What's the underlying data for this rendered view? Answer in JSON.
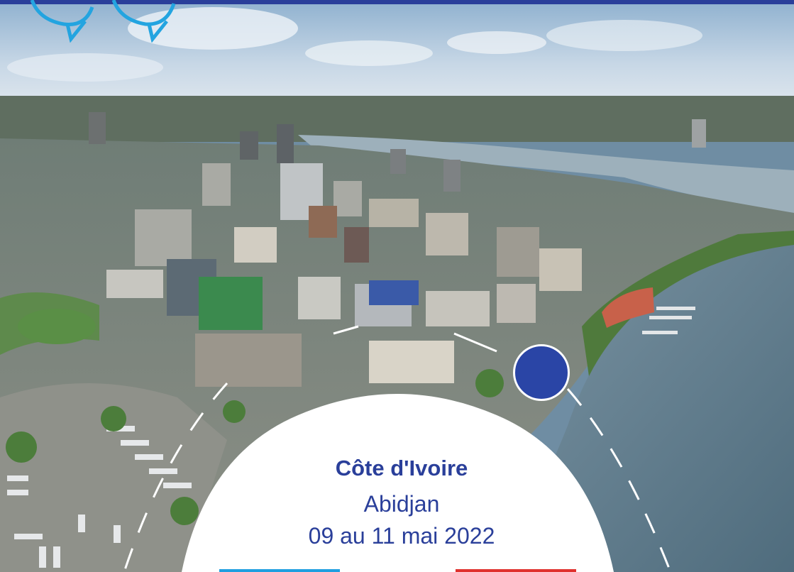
{
  "banner": {
    "country": "Côte d'Ivoire",
    "city": "Abidjan",
    "dates": "09 au 11 mai 2022"
  },
  "colors": {
    "brand_blue": "#2a3f9a",
    "marker_blue": "#2a45a6",
    "accent_light_blue": "#1f9fe0",
    "accent_red": "#e0312e",
    "lagoon": "#5d7a8a",
    "sky": "#c9d8e6"
  },
  "icons": [
    "speech-bubble-icon",
    "location-marker-icon"
  ]
}
